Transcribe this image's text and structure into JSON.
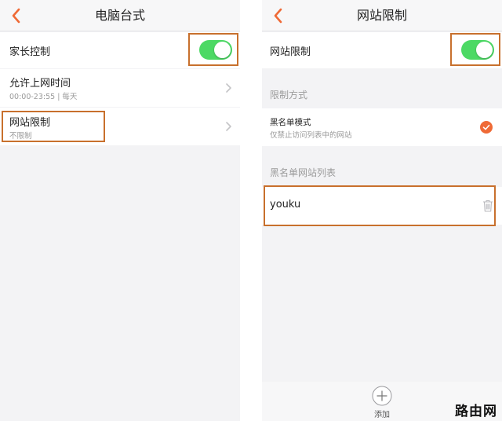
{
  "colors": {
    "accent": "#ef6a36",
    "toggle_on": "#4cd964",
    "highlight_border": "#c8702d"
  },
  "left_panel": {
    "title": "电脑台式",
    "back_icon": "chevron-left-icon",
    "parental_control": {
      "label": "家长控制",
      "enabled": true
    },
    "allowed_time": {
      "label": "允许上网时间",
      "value": "00:00-23:55 | 每天"
    },
    "website_limit": {
      "label": "网站限制",
      "value": "不限制"
    }
  },
  "right_panel": {
    "title": "网站限制",
    "back_icon": "chevron-left-icon",
    "website_limit": {
      "label": "网站限制",
      "enabled": true
    },
    "method_section": "限制方式",
    "blacklist_mode": {
      "label": "黑名单模式",
      "description": "仅禁止访问列表中的网站",
      "selected": true
    },
    "list_section": "黑名单网站列表",
    "sites": [
      {
        "name": "youku"
      }
    ],
    "add_label": "添加"
  },
  "watermark": "路由网"
}
